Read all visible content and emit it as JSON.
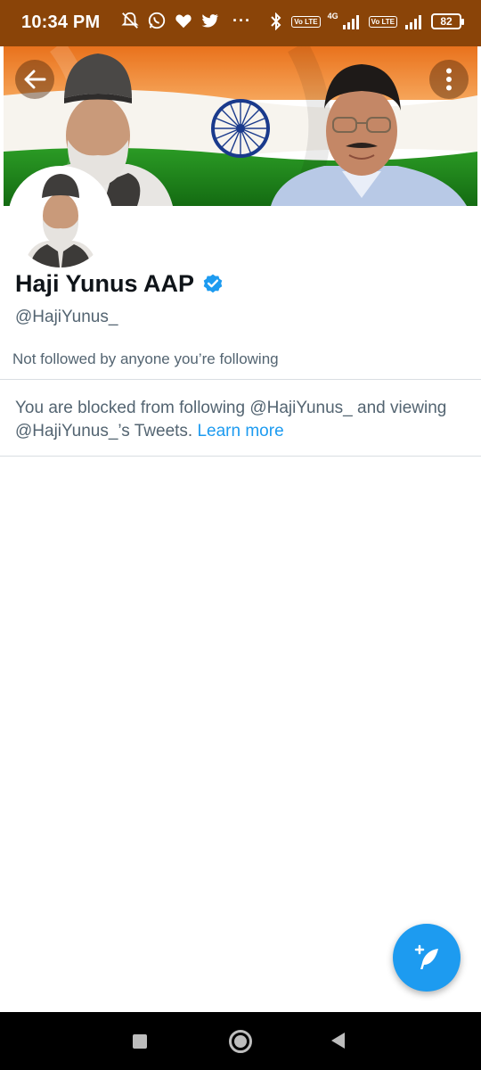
{
  "status_bar": {
    "time": "10:34 PM",
    "icons": [
      "mute-icon",
      "whatsapp-icon",
      "heart-icon",
      "twitter-icon"
    ],
    "more_dots": "···",
    "volte_label": "Vo LTE",
    "network_label": "4G",
    "battery": "82",
    "background_color": "#8a4408"
  },
  "profile": {
    "display_name": "Haji Yunus AAP",
    "handle": "@HajiYunus_",
    "verified": true,
    "followed_note": "Not followed by anyone you’re following"
  },
  "blocked": {
    "message": "You are blocked from following @HajiYunus_ and viewing @HajiYunus_’s Tweets.",
    "link_label": "Learn more"
  },
  "colors": {
    "accent": "#1d9bf0",
    "secondary_text": "#536471",
    "saffron": "#f0892a",
    "india_green": "#1f8a1c",
    "chakra_blue": "#1a3a8c"
  }
}
